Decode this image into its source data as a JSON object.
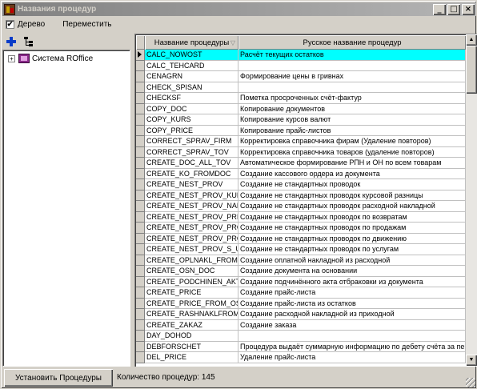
{
  "window": {
    "title": "Названия процедур",
    "buttons": {
      "minimize": "_",
      "maximize": "□",
      "close": "×"
    }
  },
  "toolbar": {
    "tree_checkbox_label": "Дерево",
    "tree_checked": true,
    "move_label": "Переместить"
  },
  "tree": {
    "nodes": [
      {
        "label": "Система ROffice",
        "expanded": false
      }
    ]
  },
  "grid": {
    "columns": {
      "name": "Название процедуры",
      "russian": "Русское название процедур"
    },
    "selected_index": 0,
    "rows": [
      {
        "name": "CALC_NOWOST",
        "russian": "Расчёт текущих остатков"
      },
      {
        "name": "CALC_TEHCARD",
        "russian": ""
      },
      {
        "name": "CENAGRN",
        "russian": "Формирование цены в гривнах"
      },
      {
        "name": "CHECK_SPISAN",
        "russian": ""
      },
      {
        "name": "CHECKSF",
        "russian": "Пометка просроченных счёт-фактур"
      },
      {
        "name": "COPY_DOC",
        "russian": "Копирование документов"
      },
      {
        "name": "COPY_KURS",
        "russian": "Копирование курсов валют"
      },
      {
        "name": "COPY_PRICE",
        "russian": "Копирование прайс-листов"
      },
      {
        "name": "CORRECT_SPRAV_FIRM",
        "russian": "Корректировка справочника фирам (Удаление повторов)"
      },
      {
        "name": "CORRECT_SPRAV_TOV",
        "russian": "Корректировка справочника товаров (удаление повторов)"
      },
      {
        "name": "CREATE_DOC_ALL_TOV",
        "russian": "Автоматическое формирование РПН и ОН по всем товарам"
      },
      {
        "name": "CREATE_KO_FROMDOC",
        "russian": "Создание кассового ордера из документа"
      },
      {
        "name": "CREATE_NEST_PROV",
        "russian": "Создание не стандартных проводок"
      },
      {
        "name": "CREATE_NEST_PROV_KURS",
        "russian": "Создание не стандартных проводок курсовой разницы"
      },
      {
        "name": "CREATE_NEST_PROV_NAKL",
        "russian": "Создание не стандартных проводок расходной накладной"
      },
      {
        "name": "CREATE_NEST_PROV_PRIB_",
        "russian": "Создание не стандартных проводок по возвратам"
      },
      {
        "name": "CREATE_NEST_PROV_PROD",
        "russian": "Создание не стандартных проводок по продажам"
      },
      {
        "name": "CREATE_NEST_PROV_PROD",
        "russian": "Создание не стандартных проводок по движению"
      },
      {
        "name": "CREATE_NEST_PROV_S_USI",
        "russian": "Создание не стандартных проводок по услугам"
      },
      {
        "name": "CREATE_OPLNAKL_FROMRA",
        "russian": "Создание оплатной накладной из расходной"
      },
      {
        "name": "CREATE_OSN_DOC",
        "russian": "Создание документа на основании"
      },
      {
        "name": "CREATE_PODCHINEN_AKT_F",
        "russian": "Создание подчинённого акта отбраковки из документа"
      },
      {
        "name": "CREATE_PRICE",
        "russian": "Создание прайс-листа"
      },
      {
        "name": "CREATE_PRICE_FROM_OST",
        "russian": "Создание прайс-листа из остатков"
      },
      {
        "name": "CREATE_RASHNAKLFROMPF",
        "russian": "Создание расходной накладной из приходной"
      },
      {
        "name": "CREATE_ZAKAZ",
        "russian": "Создание заказа"
      },
      {
        "name": "DAY_DOHOD",
        "russian": ""
      },
      {
        "name": "DEBFORSCHET",
        "russian": "Процедура выдаёт суммарную информацию по дебету счёта за пери"
      },
      {
        "name": "DEL_PRICE",
        "russian": "Удаление прайс-листа"
      }
    ]
  },
  "status": {
    "install_button": "Установить Процедуры",
    "count_text": "Количество процедур: 145"
  }
}
